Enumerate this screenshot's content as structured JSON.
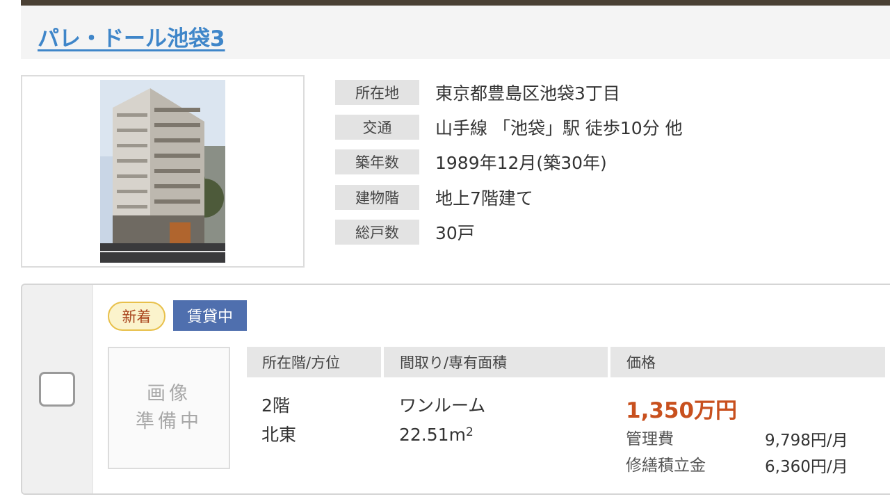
{
  "property": {
    "name": "パレ・ドール池袋3"
  },
  "info": [
    {
      "label": "所在地",
      "value": "東京都豊島区池袋3丁目"
    },
    {
      "label": "交通",
      "value": "山手線 「池袋」駅 徒歩10分 他"
    },
    {
      "label": "築年数",
      "value": "1989年12月(築30年)"
    },
    {
      "label": "建物階",
      "value": "地上7階建て"
    },
    {
      "label": "総戸数",
      "value": "30戸"
    }
  ],
  "unit": {
    "badge_new": "新着",
    "badge_status": "賃貸中",
    "no_image_line1": "画像",
    "no_image_line2": "準備中",
    "headers": {
      "floor": "所在階/方位",
      "layout": "間取り/専有面積",
      "price": "価格"
    },
    "floor": "2階",
    "direction": "北東",
    "layout": "ワンルーム",
    "area": "22.51m",
    "area_sup": "2",
    "price": "1,350万円",
    "management_fee_label": "管理費",
    "management_fee": "9,798円/月",
    "repair_fund_label": "修繕積立金",
    "repair_fund": "6,360円/月"
  },
  "colors": {
    "title_link": "#3f86c9",
    "price": "#c8501e",
    "status_badge": "#4f6fae",
    "new_badge_border": "#e8c04a"
  }
}
